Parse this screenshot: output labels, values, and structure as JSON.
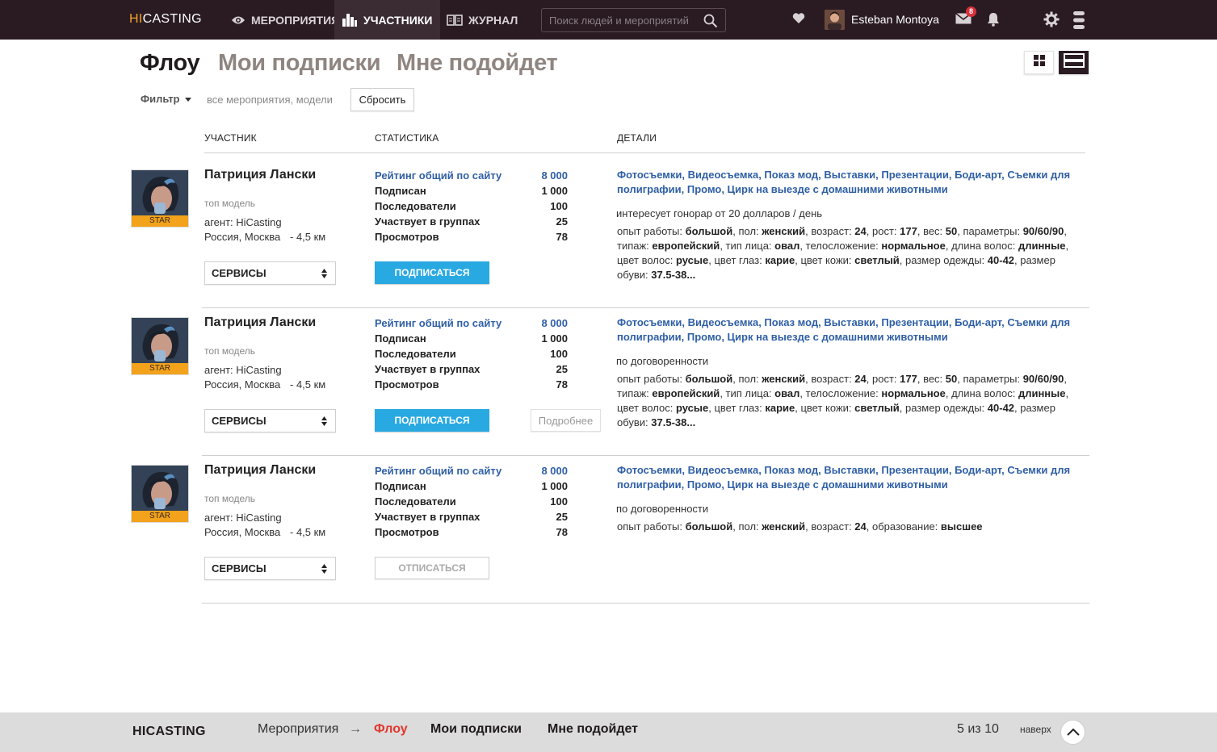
{
  "topbar": {
    "logo_hi": "HI",
    "logo_rest": "CASTING",
    "nav": [
      {
        "label": "МЕРОПРИЯТИЯ",
        "icon": "eye-icon"
      },
      {
        "label": "УЧАСТНИКИ",
        "icon": "bar-chart-icon"
      },
      {
        "label": "ЖУРНАЛ",
        "icon": "book-icon"
      }
    ],
    "search_placeholder": "Поиск людей и мероприятий",
    "username": "Esteban Montoya",
    "messages_count": "8"
  },
  "header": {
    "tabs": [
      "Флоу",
      "Мои подписки",
      "Мне подойдет"
    ],
    "active_tab": "Флоу"
  },
  "filter": {
    "label": "Фильтр",
    "value": "все мероприятия, модели",
    "reset_label": "Сбросить"
  },
  "columns": [
    "УЧАСТНИК",
    "СТАТИСТИКА",
    "ДЕТАЛИ"
  ],
  "participants": [
    {
      "name": "Патриция Лански",
      "role": "топ модель",
      "badge": "STAR",
      "agent": "агент: HiCasting",
      "location": "Россия, Москва",
      "distance": "- 4,5 км",
      "services_label": "СЕРВИСЫ",
      "stats": [
        {
          "label": "Рейтинг общий по сайту",
          "value": "8 000"
        },
        {
          "label": "Подписан",
          "value": "1 000"
        },
        {
          "label": "Последователи",
          "value": "100"
        },
        {
          "label": "Участвует в группах",
          "value": "25"
        },
        {
          "label": "Просмотров",
          "value": "78"
        }
      ],
      "action_label": "ПОДПИСАТЬСЯ",
      "action_type": "subscribe",
      "more_label": "",
      "services": "Фотосъемки, Видеосъемка, Показ мод, Выставки, Презентации, Боди-арт, Съемки для полиграфии, Промо, Цирк на выезде с домашними животными",
      "fee": "интересует гонорар от 20 долларов / день",
      "params": [
        {
          "k": "опыт работы: ",
          "v": "большой"
        },
        {
          "k": ", пол: ",
          "v": "женский"
        },
        {
          "k": ", возраст: ",
          "v": "24"
        },
        {
          "k": ", рост: ",
          "v": "177"
        },
        {
          "k": ", вес: ",
          "v": "50"
        },
        {
          "k": ", параметры: ",
          "v": "90/60/90"
        },
        {
          "k": ", типаж: ",
          "v": "европейский"
        },
        {
          "k": ", тип лица: ",
          "v": "овал"
        },
        {
          "k": ", телосложение: ",
          "v": "нормальное"
        },
        {
          "k": ", длина волос: ",
          "v": "длинные"
        },
        {
          "k": ", цвет волос: ",
          "v": "русые"
        },
        {
          "k": ", цвет глаз: ",
          "v": "карие"
        },
        {
          "k": ", цвет кожи: ",
          "v": "светлый"
        },
        {
          "k": ", размер одежды: ",
          "v": "40-42"
        },
        {
          "k": ", размер обуви: ",
          "v": "37.5-38..."
        }
      ]
    },
    {
      "name": "Патриция Лански",
      "role": "топ модель",
      "badge": "STAR",
      "agent": "агент: HiCasting",
      "location": "Россия, Москва",
      "distance": "- 4,5 км",
      "services_label": "СЕРВИСЫ",
      "stats": [
        {
          "label": "Рейтинг общий по сайту",
          "value": "8 000"
        },
        {
          "label": "Подписан",
          "value": "1 000"
        },
        {
          "label": "Последователи",
          "value": "100"
        },
        {
          "label": "Участвует в группах",
          "value": "25"
        },
        {
          "label": "Просмотров",
          "value": "78"
        }
      ],
      "action_label": "ПОДПИСАТЬСЯ",
      "action_type": "subscribe",
      "more_label": "Подробнее",
      "services": "Фотосъемки, Видеосъемка, Показ мод, Выставки, Презентации, Боди-арт, Съемки для полиграфии, Промо, Цирк на выезде с домашними животными",
      "fee": "по договоренности",
      "params": [
        {
          "k": "опыт работы: ",
          "v": "большой"
        },
        {
          "k": ", пол: ",
          "v": "женский"
        },
        {
          "k": ", возраст: ",
          "v": "24"
        },
        {
          "k": ", рост: ",
          "v": "177"
        },
        {
          "k": ", вес: ",
          "v": "50"
        },
        {
          "k": ", параметры: ",
          "v": "90/60/90"
        },
        {
          "k": ", типаж: ",
          "v": "европейский"
        },
        {
          "k": ", тип лица: ",
          "v": "овал"
        },
        {
          "k": ", телосложение: ",
          "v": "нормальное"
        },
        {
          "k": ", длина волос: ",
          "v": "длинные"
        },
        {
          "k": ", цвет волос: ",
          "v": "русые"
        },
        {
          "k": ", цвет глаз: ",
          "v": "карие"
        },
        {
          "k": ", цвет кожи: ",
          "v": "светлый"
        },
        {
          "k": ", размер одежды: ",
          "v": "40-42"
        },
        {
          "k": ", размер обуви: ",
          "v": "37.5-38..."
        }
      ]
    },
    {
      "name": "Патриция Лански",
      "role": "топ модель",
      "badge": "STAR",
      "agent": "агент: HiCasting",
      "location": "Россия, Москва",
      "distance": "- 4,5 км",
      "services_label": "СЕРВИСЫ",
      "stats": [
        {
          "label": "Рейтинг общий по сайту",
          "value": "8 000"
        },
        {
          "label": "Подписан",
          "value": "1 000"
        },
        {
          "label": "Последователи",
          "value": "100"
        },
        {
          "label": "Участвует в группах",
          "value": "25"
        },
        {
          "label": "Просмотров",
          "value": "78"
        }
      ],
      "action_label": "ОТПИСАТЬСЯ",
      "action_type": "unsubscribe",
      "more_label": "",
      "services": "Фотосъемки, Видеосъемка, Показ мод, Выставки, Презентации, Боди-арт, Съемки для полиграфии, Промо, Цирк на выезде с домашними животными",
      "fee": "по договоренности",
      "params": [
        {
          "k": "опыт работы: ",
          "v": "большой"
        },
        {
          "k": ", пол: ",
          "v": "женский"
        },
        {
          "k": ", возраст: ",
          "v": "24"
        },
        {
          "k": ", образование: ",
          "v": "высшее"
        }
      ]
    }
  ],
  "footer": {
    "logo": "HICASTING",
    "crumb_root": "Мероприятия",
    "crumb_arrow": "→",
    "tabs": [
      "Флоу",
      "Мои подписки",
      "Мне подойдет"
    ],
    "pages": "5 из 10",
    "to_top": "наверх"
  },
  "colors": {
    "topbar": "#2a1b22",
    "accent_blue": "#29a9e2",
    "link_blue": "#2f5fa5",
    "star_badge": "#f2a21b",
    "footer_active": "#e0392c"
  }
}
